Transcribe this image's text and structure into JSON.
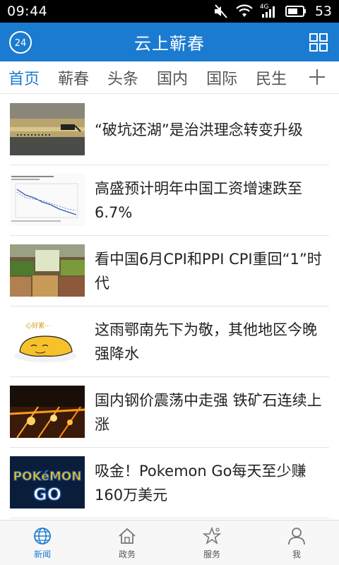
{
  "status_bar": {
    "time": "09:44",
    "network_type": "4G",
    "battery_level": "53",
    "icons": [
      "mute-icon",
      "wifi-icon",
      "signal-icon",
      "battery-icon"
    ]
  },
  "header": {
    "logo_text": "24",
    "title": "云上蕲春",
    "menu_icon": "grid-icon"
  },
  "tabs": [
    {
      "label": "首页",
      "active": true
    },
    {
      "label": "蕲春",
      "active": false
    },
    {
      "label": "头条",
      "active": false
    },
    {
      "label": "国内",
      "active": false
    },
    {
      "label": "国际",
      "active": false
    },
    {
      "label": "民生",
      "active": false
    }
  ],
  "tabs_add_icon": "plus-icon",
  "news": [
    {
      "title": "“破坑还湖”是治洪理念转变升级",
      "thumb": "lake-excavator-photo"
    },
    {
      "title": "高盛预计明年中国工资增速跌至6.7%",
      "thumb": "wage-growth-chart-image"
    },
    {
      "title": "看中国6月CPI和PPI  CPI重回“1”时代",
      "thumb": "vegetable-market-photo"
    },
    {
      "title": "这雨鄂南先下为敬，其他地区今晚强降水",
      "thumb": "lazy-egg-cartoon"
    },
    {
      "title": "国内钢价震荡中走强 铁矿石连续上涨",
      "thumb": "steel-mill-sparks-photo"
    },
    {
      "title": "吸金！Pokemon Go每天至少赚160万美元",
      "thumb": "pokemon-go-logo"
    }
  ],
  "thumb_texts": {
    "cartoon_caption": "心好累···",
    "pokemon_logo_top": "POKéMON",
    "pokemon_logo_bottom": "GO"
  },
  "bottom_nav": [
    {
      "label": "新闻",
      "icon": "globe-icon",
      "active": true
    },
    {
      "label": "政务",
      "icon": "home-icon",
      "active": false
    },
    {
      "label": "服务",
      "icon": "star-icon",
      "active": false
    },
    {
      "label": "我",
      "icon": "user-icon",
      "active": false
    }
  ],
  "colors": {
    "accent": "#1a7bd0",
    "status_bar": "#000000",
    "text": "#222222"
  }
}
